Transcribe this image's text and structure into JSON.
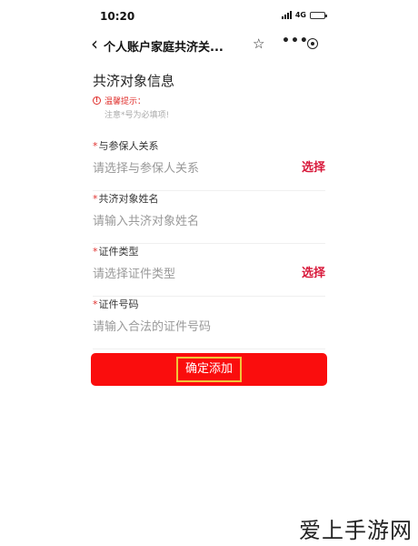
{
  "status_bar": {
    "time": "10:20",
    "network": "4G"
  },
  "nav": {
    "title": "个人账户家庭共济关...",
    "back_icon": "chevron-left-icon",
    "star_icon": "star-icon",
    "more_icon": "more-icon",
    "record_icon": "record-icon"
  },
  "form": {
    "section_title": "共济对象信息",
    "tip_title": "温馨提示：",
    "tip_note": "注意*号为必填项!",
    "required_mark": "*",
    "fields": [
      {
        "label": "与参保人关系",
        "placeholder": "请选择与参保人关系",
        "action": "选择"
      },
      {
        "label": "共济对象姓名",
        "placeholder": "请输入共济对象姓名",
        "action": ""
      },
      {
        "label": "证件类型",
        "placeholder": "请选择证件类型",
        "action": "选择"
      },
      {
        "label": "证件号码",
        "placeholder": "请输入合法的证件号码",
        "action": ""
      }
    ],
    "confirm_label": "确定添加"
  },
  "watermark": "爱上手游网",
  "colors": {
    "accent_red": "#fa0d0d",
    "action_red": "#d8183a",
    "highlight_border": "#f0c43a"
  }
}
